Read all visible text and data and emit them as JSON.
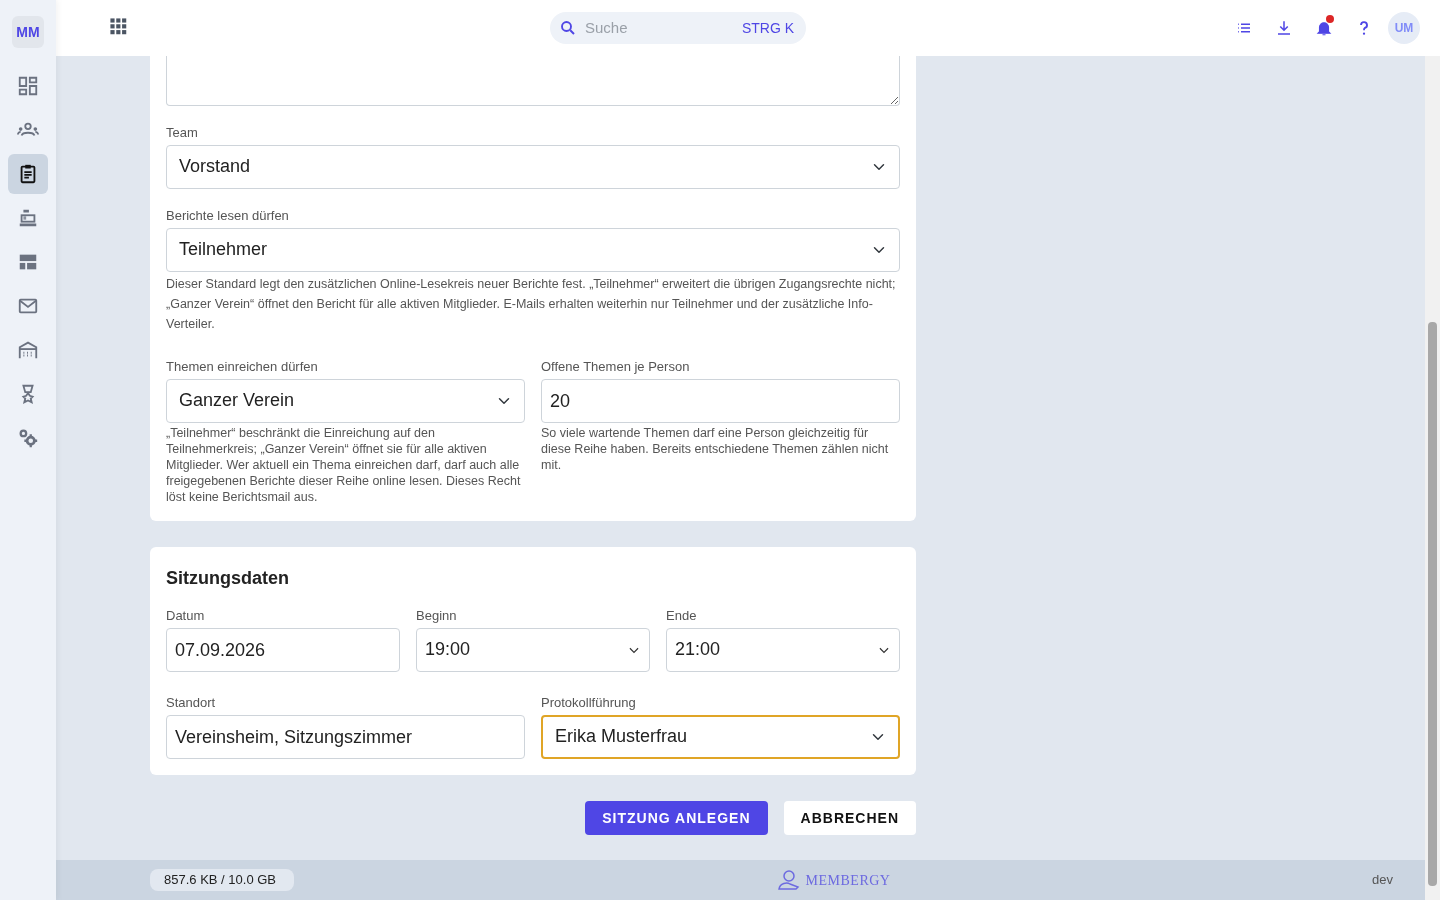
{
  "sidebar": {
    "logo": "MM",
    "items": [
      {
        "selected": false
      },
      {
        "selected": false
      },
      {
        "selected": true
      },
      {
        "selected": false
      },
      {
        "selected": false
      },
      {
        "selected": false
      },
      {
        "selected": false
      },
      {
        "selected": false
      },
      {
        "selected": false
      }
    ]
  },
  "topbar": {
    "search": {
      "placeholder": "Suche",
      "shortcut": "STRG K"
    },
    "notifications_unread": true,
    "avatar": "UM"
  },
  "settings": {
    "fields": [
      {
        "kind": "textarea"
      },
      {
        "kind": "select",
        "label": "Team",
        "value": "Vorstand"
      },
      {
        "kind": "select",
        "label": "Berichte lesen dürfen",
        "value": "Teilnehmer",
        "help": "Dieser Standard legt den zusätzlichen Online-Lesekreis neuer Berichte fest. „Teilnehmer“ erweitert die übrigen Zugangsrechte nicht; „Ganzer Verein“ öffnet den Bericht für alle aktiven Mitglieder. E-Mails erhalten weiterhin nur Teilnehmer und der zusätzliche Info-Verteiler."
      }
    ],
    "columns": [
      {
        "kind": "select",
        "label": "Themen einreichen dürfen",
        "value": "Ganzer Verein",
        "help": "„Teilnehmer“ beschränkt die Einreichung auf den Teilnehmerkreis; „Ganzer Verein“ öffnet sie für alle aktiven Mitglieder. Wer aktuell ein Thema einreichen darf, darf auch alle freigegebenen Berichte dieser Reihe online lesen. Dieses Recht löst keine Berichtsmail aus."
      },
      {
        "kind": "input",
        "label": "Offene Themen je Person",
        "value": "20",
        "help": "So viele wartende Themen darf eine Person gleichzeitig für diese Reihe haben. Bereits entschiedene Themen zählen nicht mit."
      }
    ]
  },
  "session": {
    "title": "Sitzungsdaten",
    "rows": [
      [
        {
          "kind": "input",
          "label": "Datum",
          "value": "07.09.2026",
          "focused": false
        },
        {
          "kind": "dropdown",
          "label": "Beginn",
          "value": "19:00",
          "focused": false
        },
        {
          "kind": "dropdown",
          "label": "Ende",
          "value": "21:00",
          "focused": false
        }
      ],
      [
        {
          "kind": "input",
          "label": "Standort",
          "value": "Vereinsheim, Sitzungszimmer",
          "focused": false
        },
        {
          "kind": "select",
          "label": "Protokollführung",
          "value": "Erika Musterfrau",
          "focused": true
        }
      ]
    ]
  },
  "buttons": [
    {
      "kind": "primary",
      "label": "SITZUNG ANLEGEN"
    },
    {
      "kind": "secondary",
      "label": "ABBRECHEN"
    }
  ],
  "footer": {
    "storage": "857.6 KB / 10.0 GB",
    "brand": "MEMBERGY",
    "environment": "dev"
  }
}
